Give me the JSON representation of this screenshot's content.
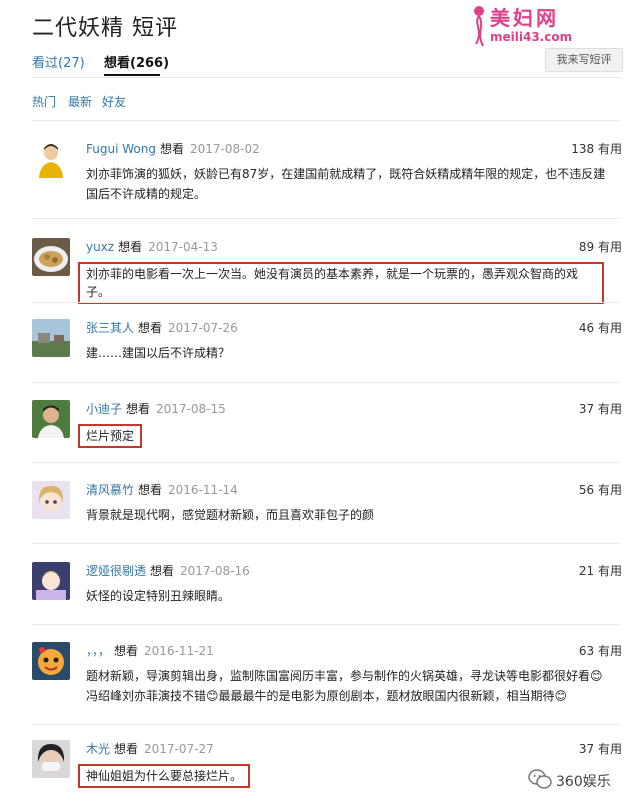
{
  "title": "二代妖精 短评",
  "watermark": {
    "name": "美妇网",
    "url": "meili43.com"
  },
  "tabs": {
    "seen": "看过(27)",
    "want": "想看(266)"
  },
  "write_button": "我来写短评",
  "sort": {
    "hot": "热门",
    "new": "最新",
    "friends": "好友"
  },
  "colors": {
    "link": "#3377aa",
    "highlight": "#c0392b"
  },
  "comments": [
    {
      "user": "Fugui Wong",
      "status": "想看",
      "date": "2017-08-02",
      "useful": "138 有用",
      "text": "刘亦菲饰演的狐妖，妖龄已有87岁，在建国前就成精了，既符合妖精成精年限的规定，也不违反建国后不许成精的规定。",
      "highlighted": false
    },
    {
      "user": "yuxz",
      "status": "想看",
      "date": "2017-04-13",
      "useful": "89 有用",
      "text": "刘亦菲的电影看一次上一次当。她没有演员的基本素养，就是一个玩票的，愚弄观众智商的戏子。",
      "highlighted": true
    },
    {
      "user": "张三其人",
      "status": "想看",
      "date": "2017-07-26",
      "useful": "46 有用",
      "text": "建……建国以后不许成精？",
      "highlighted": false
    },
    {
      "user": "小迪子",
      "status": "想看",
      "date": "2017-08-15",
      "useful": "37 有用",
      "text": "烂片预定",
      "highlighted": true
    },
    {
      "user": "清风慕竹",
      "status": "想看",
      "date": "2016-11-14",
      "useful": "56 有用",
      "text": "背景就是现代啊，感觉题材新颖，而且喜欢菲包子的颜",
      "highlighted": false
    },
    {
      "user": "逻娅很剔透",
      "status": "想看",
      "date": "2017-08-16",
      "useful": "21 有用",
      "text": "妖怪的设定特别丑辣眼睛。",
      "highlighted": false
    },
    {
      "user": "，，，",
      "status": "想看",
      "date": "2016-11-21",
      "useful": "63 有用",
      "text": "题材新颖，导演剪辑出身，监制陈国富阅历丰富，参与制作的火锅英雄，寻龙诀等电影都很好看😊冯绍峰刘亦菲演技不错😊最最最牛的是电影为原创剧本，题材放眼国内很新颖，相当期待😊",
      "highlighted": false
    },
    {
      "user": "木光",
      "status": "想看",
      "date": "2017-07-27",
      "useful": "37 有用",
      "text": "神仙姐姐为什么要总接烂片。",
      "highlighted": true
    }
  ],
  "source": "360娱乐"
}
